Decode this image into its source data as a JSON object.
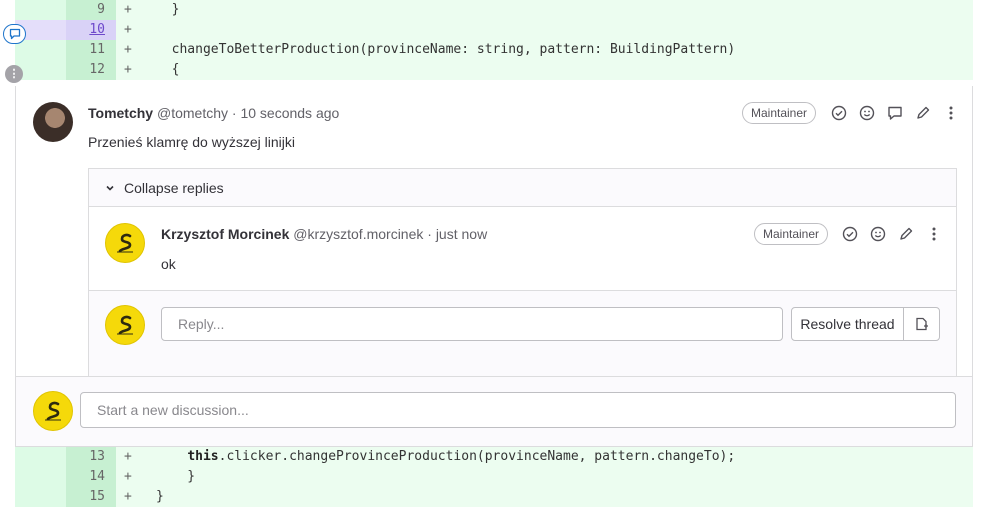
{
  "diff_top": [
    {
      "new_line": "9",
      "sign": "+",
      "code": "  }"
    },
    {
      "new_line": "10",
      "sign": "+",
      "code": ""
    },
    {
      "new_line": "11",
      "sign": "+",
      "code": "  changeToBetterProduction(provinceName: string, pattern: BuildingPattern)"
    },
    {
      "new_line": "12",
      "sign": "+",
      "code": "  {"
    }
  ],
  "diff_bottom": [
    {
      "new_line": "13",
      "sign": "+",
      "kw": "this",
      "code": ".clicker.changeProvinceProduction(provinceName, pattern.changeTo);"
    },
    {
      "new_line": "14",
      "sign": "+",
      "code": "    }"
    },
    {
      "new_line": "15",
      "sign": "+",
      "code": "}"
    }
  ],
  "note": {
    "author": "Tometchy",
    "handle": "@tometchy",
    "time": "· 10 seconds ago",
    "role": "Maintainer",
    "body": "Przenieś klamrę do wyższej linijki"
  },
  "collapse_label": "Collapse replies",
  "reply": {
    "author": "Krzysztof Morcinek",
    "handle": "@krzysztof.morcinek",
    "time": "· just now",
    "role": "Maintainer",
    "body": "ok"
  },
  "reply_input": {
    "placeholder": "Reply..."
  },
  "resolve_button": "Resolve thread",
  "new_discussion": {
    "placeholder": "Start a new discussion..."
  },
  "colors": {
    "added_line": "#ecfdf0",
    "highlight": "#d9d2f7",
    "accent": "#1f75cb"
  }
}
